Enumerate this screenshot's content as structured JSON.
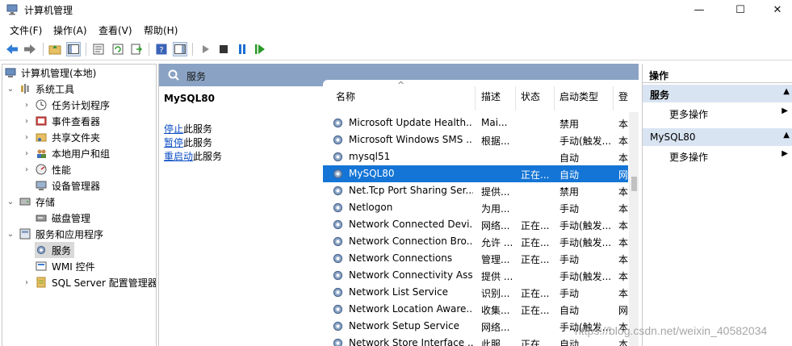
{
  "window": {
    "title": "计算机管理",
    "minimize": "—",
    "maximize": "☐",
    "close": "✕"
  },
  "menu": [
    "文件(F)",
    "操作(A)",
    "查看(V)",
    "帮助(H)"
  ],
  "tree": {
    "root": "计算机管理(本地)",
    "system_tools": "系统工具",
    "task_scheduler": "任务计划程序",
    "event_viewer": "事件查看器",
    "shared_folders": "共享文件夹",
    "local_users": "本地用户和组",
    "performance": "性能",
    "device_manager": "设备管理器",
    "storage": "存储",
    "disk_management": "磁盘管理",
    "services_apps": "服务和应用程序",
    "services": "服务",
    "wmi": "WMI 控件",
    "sql_server": "SQL Server 配置管理器"
  },
  "services_header": "服务",
  "detail": {
    "title": "MySQL80",
    "stop_link": "停止",
    "stop_suffix": "此服务",
    "pause_link": "暂停",
    "pause_suffix": "此服务",
    "restart_link": "重启动",
    "restart_suffix": "此服务"
  },
  "columns": {
    "name": "名称",
    "desc": "描述",
    "status": "状态",
    "startup": "启动类型",
    "logon": "登"
  },
  "rows": [
    {
      "name": "Microsoft Update Health...",
      "desc": "Mai...",
      "status": "",
      "startup": "禁用",
      "logon": "本"
    },
    {
      "name": "Microsoft Windows SMS ...",
      "desc": "根据...",
      "status": "",
      "startup": "手动(触发...",
      "logon": "本"
    },
    {
      "name": "mysql51",
      "desc": "",
      "status": "",
      "startup": "自动",
      "logon": "本"
    },
    {
      "name": "MySQL80",
      "desc": "",
      "status": "正在...",
      "startup": "自动",
      "logon": "网"
    },
    {
      "name": "Net.Tcp Port Sharing Ser...",
      "desc": "提供...",
      "status": "",
      "startup": "禁用",
      "logon": "本"
    },
    {
      "name": "Netlogon",
      "desc": "为用...",
      "status": "",
      "startup": "手动",
      "logon": "本"
    },
    {
      "name": "Network Connected Devi...",
      "desc": "网络...",
      "status": "正在...",
      "startup": "手动(触发...",
      "logon": "本"
    },
    {
      "name": "Network Connection Bro...",
      "desc": "允许 ...",
      "status": "正在...",
      "startup": "手动(触发...",
      "logon": "本"
    },
    {
      "name": "Network Connections",
      "desc": "管理...",
      "status": "正在...",
      "startup": "手动",
      "logon": "本"
    },
    {
      "name": "Network Connectivity Ass...",
      "desc": "提供 ...",
      "status": "",
      "startup": "手动(触发...",
      "logon": "本"
    },
    {
      "name": "Network List Service",
      "desc": "识别...",
      "status": "正在...",
      "startup": "手动",
      "logon": "本"
    },
    {
      "name": "Network Location Aware...",
      "desc": "收集...",
      "status": "正在...",
      "startup": "自动",
      "logon": "网"
    },
    {
      "name": "Network Setup Service",
      "desc": "网络...",
      "status": "",
      "startup": "手动(触发...",
      "logon": "本"
    },
    {
      "name": "Network Store Interface ...",
      "desc": "此服...",
      "status": "正在...",
      "startup": "自动",
      "logon": "本"
    }
  ],
  "actions": {
    "title": "操作",
    "group1": "服务",
    "group1_more": "更多操作",
    "group2": "MySQL80",
    "group2_more": "更多操作"
  },
  "watermark": "https://blog.csdn.net/weixin_40582034",
  "colors": {
    "selection": "#1475d6",
    "header_band": "#8aa3c4",
    "action_group": "#d9e4f3",
    "link": "#0b4dc4"
  }
}
